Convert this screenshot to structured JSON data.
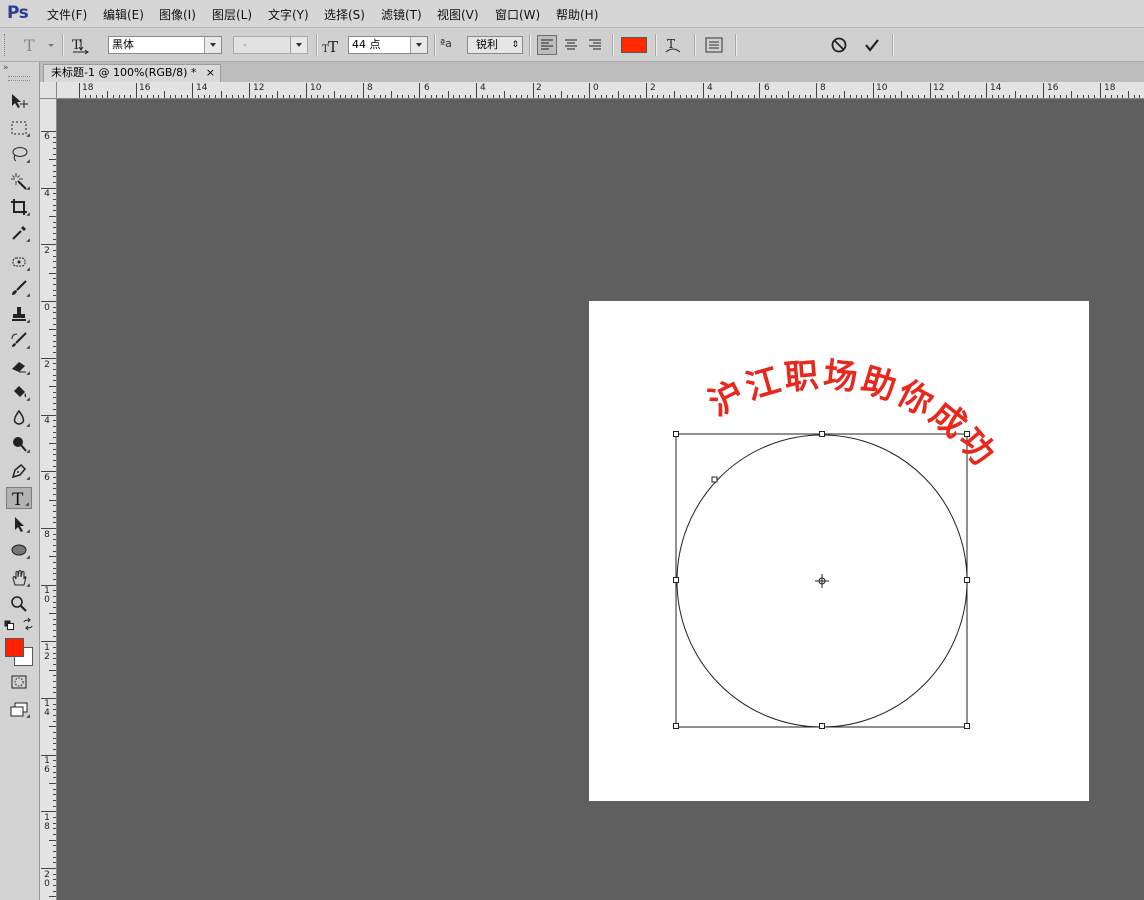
{
  "app": {
    "logo": "Ps"
  },
  "menu": [
    "文件(F)",
    "编辑(E)",
    "图像(I)",
    "图层(L)",
    "文字(Y)",
    "选择(S)",
    "滤镜(T)",
    "视图(V)",
    "窗口(W)",
    "帮助(H)"
  ],
  "options": {
    "font_family": "黑体",
    "font_style": "-",
    "font_size": "44 点",
    "aa_label": "ªa",
    "antialias": "锐利",
    "text_color": "#ff2a00"
  },
  "document": {
    "tab_title": "未标题-1 @ 100%(RGB/8) *",
    "close_glyph": "×",
    "path_text": "沪江职场助你成功",
    "text_color": "#e8281c"
  },
  "colors": {
    "foreground": "#ff2200",
    "background": "#ffffff"
  },
  "ruler": {
    "top": [
      "18",
      "16",
      "14",
      "12",
      "10",
      "8",
      "6",
      "4",
      "2",
      "0",
      "2",
      "4",
      "6",
      "8",
      "10",
      "12",
      "14",
      "16",
      "18"
    ],
    "left": [
      "6",
      "4",
      "2",
      "0",
      "2",
      "4",
      "6",
      "8",
      "10",
      "12",
      "14",
      "16",
      "18",
      "20"
    ]
  }
}
